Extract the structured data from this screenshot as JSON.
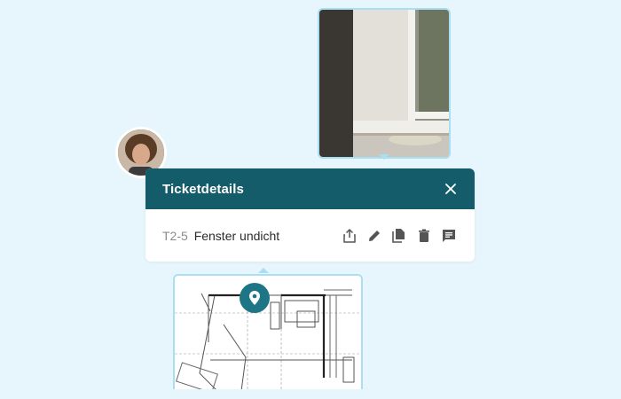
{
  "ticket": {
    "title": "Ticketdetails",
    "id": "T2-5",
    "name": "Fenster undicht"
  },
  "icons": {
    "close": "close-icon",
    "share": "share-icon",
    "edit": "edit-icon",
    "copy": "copy-icon",
    "delete": "delete-icon",
    "comment": "comment-icon",
    "location": "location-pin-icon"
  },
  "colors": {
    "background": "#e7f5fc",
    "header": "#155c6a",
    "accent_border": "#a9dff0",
    "pin": "#1d7585"
  }
}
